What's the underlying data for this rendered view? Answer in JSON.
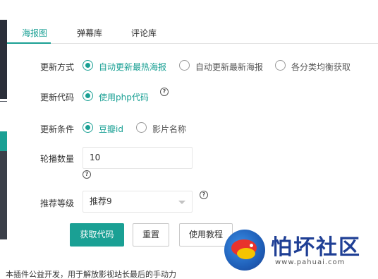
{
  "colors": {
    "accent": "#1aa094",
    "primary_button": "#1aa094",
    "watermark_blue": "#1f3f95"
  },
  "tabs": [
    {
      "label": "海报图",
      "active": true
    },
    {
      "label": "弹幕库",
      "active": false
    },
    {
      "label": "评论库",
      "active": false
    }
  ],
  "form": {
    "update_method": {
      "label": "更新方式",
      "options": [
        {
          "label": "自动更新最热海报",
          "checked": true
        },
        {
          "label": "自动更新最新海报",
          "checked": false
        },
        {
          "label": "各分类均衡获取",
          "checked": false
        }
      ]
    },
    "update_code": {
      "label": "更新代码",
      "options": [
        {
          "label": "使用php代码",
          "checked": true
        }
      ],
      "help_icon": "question-circle-icon"
    },
    "update_condition": {
      "label": "更新条件",
      "options": [
        {
          "label": "豆瓣id",
          "checked": true
        },
        {
          "label": "影片名称",
          "checked": false
        }
      ]
    },
    "carousel_count": {
      "label": "轮播数量",
      "value": "10",
      "help_icon": "question-circle-icon"
    },
    "recommend_level": {
      "label": "推荐等级",
      "selected": "推荐9",
      "help_icon": "question-circle-icon"
    }
  },
  "buttons": {
    "get_code": "获取代码",
    "reset": "重置",
    "tutorial": "使用教程"
  },
  "footer": {
    "text": "本插件公益开发，用于解放影视站长最后的手动力"
  },
  "watermark": {
    "title": "怕坏社区",
    "url": "www.pahuai.com"
  }
}
